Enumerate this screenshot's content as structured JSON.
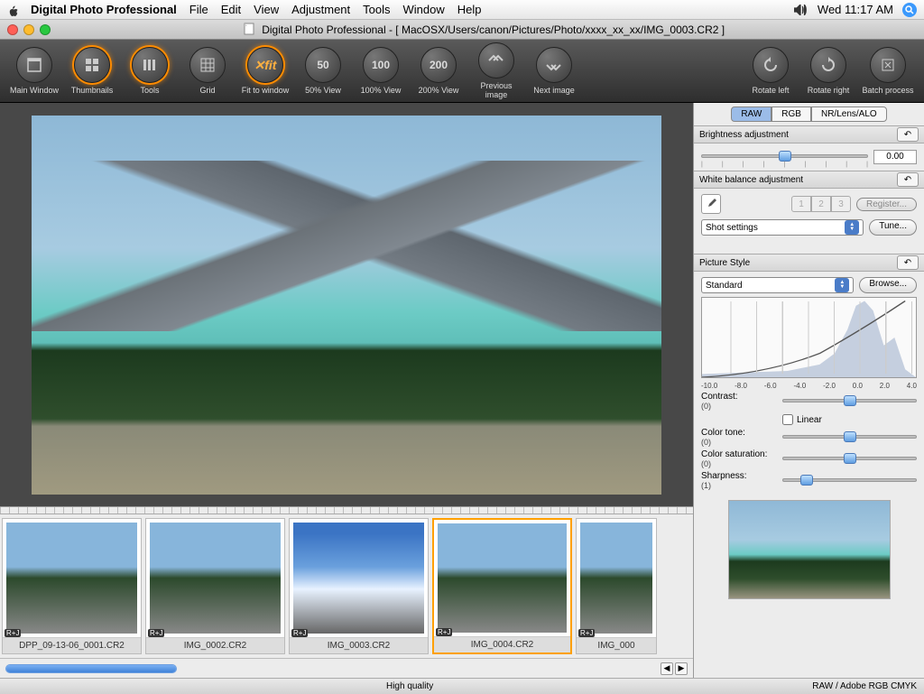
{
  "menubar": {
    "appname": "Digital Photo Professional",
    "items": [
      "File",
      "Edit",
      "View",
      "Adjustment",
      "Tools",
      "Window",
      "Help"
    ],
    "clock": "Wed 11:17 AM"
  },
  "titlebar": {
    "prefix": "Digital Photo Professional - ",
    "path": "[ MacOSX/Users/canon/Pictures/Photo/xxxx_xx_xx/IMG_0003.CR2 ]"
  },
  "toolbar": {
    "main_window": "Main Window",
    "thumbnails": "Thumbnails",
    "tools": "Tools",
    "grid": "Grid",
    "fit": "Fit to window",
    "p50": "50% View",
    "p100": "100% View",
    "p200": "200% View",
    "prev": "Previous image",
    "next": "Next image",
    "rotate_left": "Rotate left",
    "rotate_right": "Rotate right",
    "batch": "Batch process"
  },
  "tabs": {
    "raw": "RAW",
    "rgb": "RGB",
    "nr": "NR/Lens/ALO"
  },
  "brightness": {
    "title": "Brightness adjustment",
    "value": "0.00"
  },
  "wb": {
    "title": "White balance adjustment",
    "register": "Register...",
    "presets": [
      "1",
      "2",
      "3"
    ],
    "shot_settings": "Shot settings",
    "tune": "Tune..."
  },
  "picstyle": {
    "title": "Picture Style",
    "value": "Standard",
    "browse": "Browse...",
    "axis": [
      "-10.0",
      "-8.0",
      "-6.0",
      "-4.0",
      "-2.0",
      "0.0",
      "2.0",
      "4.0"
    ],
    "contrast": "Contrast:",
    "contrast_v": "(0)",
    "linear": "Linear",
    "tone": "Color tone:",
    "tone_v": "(0)",
    "sat": "Color saturation:",
    "sat_v": "(0)",
    "sharp": "Sharpness:",
    "sharp_v": "(1)"
  },
  "thumbs": [
    {
      "name": "DPP_09-13-06_0001.CR2",
      "badge": "R+J"
    },
    {
      "name": "IMG_0002.CR2",
      "badge": "R+J"
    },
    {
      "name": "IMG_0003.CR2",
      "badge": "R+J"
    },
    {
      "name": "IMG_0004.CR2",
      "badge": "R+J"
    },
    {
      "name": "IMG_000",
      "badge": "R+J"
    }
  ],
  "status": {
    "center": "High quality",
    "right": "RAW / Adobe RGB  CMYK"
  }
}
